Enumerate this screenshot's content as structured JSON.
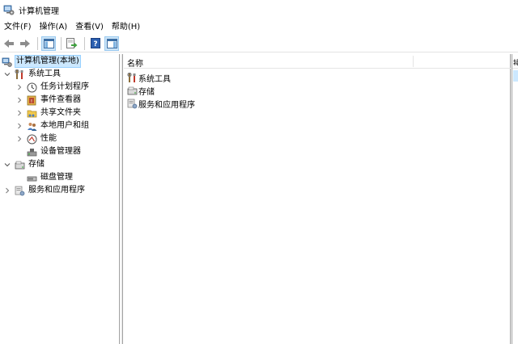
{
  "window": {
    "title": "计算机管理"
  },
  "menu": [
    "文件(F)",
    "操作(A)",
    "查看(V)",
    "帮助(H)"
  ],
  "toolbar": {
    "buttons": [
      "back-arrow-icon",
      "forward-arrow-icon",
      "show-hide-console-tree-icon",
      "export-list-icon",
      "help-icon",
      "show-hide-action-pane-icon"
    ]
  },
  "tree": {
    "root": "计算机管理(本地)",
    "system_tools": "系统工具",
    "task_scheduler": "任务计划程序",
    "event_viewer": "事件查看器",
    "shared_folders": "共享文件夹",
    "local_users": "本地用户和组",
    "performance": "性能",
    "device_manager": "设备管理器",
    "storage": "存储",
    "disk_management": "磁盘管理",
    "services_apps": "服务和应用程序"
  },
  "list": {
    "column_name": "名称",
    "items": [
      "系统工具",
      "存储",
      "服务和应用程序"
    ]
  },
  "actions": {
    "header": "操"
  },
  "colors": {
    "selection": "#cce8ff",
    "selection_border": "#99d1ff",
    "pane_border": "#a0a0a0"
  }
}
